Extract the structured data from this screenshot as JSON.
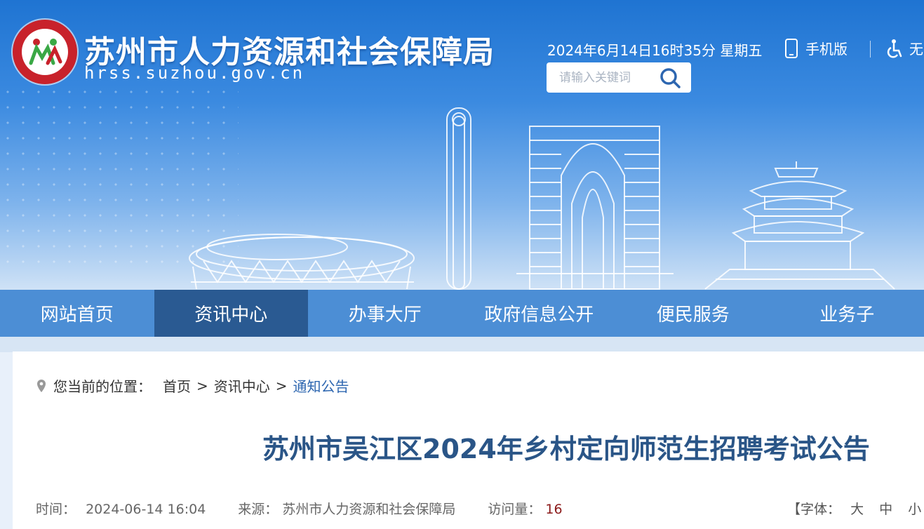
{
  "header": {
    "site_name": "苏州市人力资源和社会保障局",
    "domain": "hrss.suzhou.gov.cn",
    "datetime": "2024年6月14日16时35分 星期五",
    "mobile_label": "手机版",
    "access_label": "无",
    "search_placeholder": "请输入关键词"
  },
  "nav": {
    "items": [
      {
        "label": "网站首页"
      },
      {
        "label": "资讯中心"
      },
      {
        "label": "办事大厅"
      },
      {
        "label": "政府信息公开"
      },
      {
        "label": "便民服务"
      },
      {
        "label": "业务子"
      }
    ],
    "active_index": 1
  },
  "breadcrumb": {
    "prefix": "您当前的位置：",
    "home": "首页",
    "section": "资讯中心",
    "current": "通知公告",
    "separator": ">"
  },
  "article": {
    "title": "苏州市吴江区2024年乡村定向师范生招聘考试公告",
    "time_label": "时间：",
    "time_value": "2024-06-14 16:04",
    "source_label": "来源：",
    "source_value": "苏州市人力资源和社会保障局",
    "views_label": "访问量：",
    "views_value": "16",
    "font_label": "【字体：",
    "font_large": "大",
    "font_medium": "中",
    "font_small": "小",
    "font_close": "】"
  },
  "colors": {
    "nav_bg": "#4c8ed5",
    "nav_active": "#2a5a92",
    "title": "#2a5587",
    "link": "#2d66b0",
    "logo_red": "#c8222b"
  }
}
